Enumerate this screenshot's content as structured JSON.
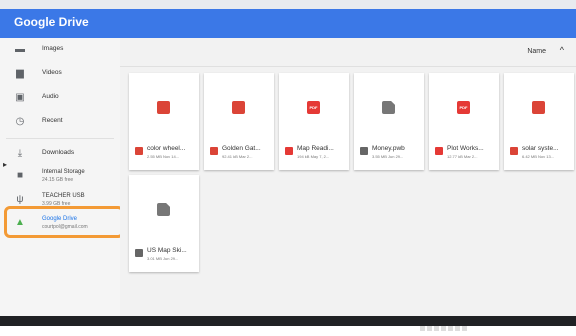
{
  "header": {
    "title": "Google Drive"
  },
  "sidebar": {
    "items": [
      {
        "label": "Images",
        "icon": "image-icon"
      },
      {
        "label": "Videos",
        "icon": "video-icon"
      },
      {
        "label": "Audio",
        "icon": "audio-icon"
      },
      {
        "label": "Recent",
        "icon": "clock-icon"
      },
      {
        "label": "Downloads",
        "icon": "download-icon"
      },
      {
        "label": "Internal Storage",
        "sub": "24.15 GB free",
        "icon": "folder-icon"
      },
      {
        "label": "TEACHER USB",
        "sub": "3.99 GB free",
        "icon": "usb-icon"
      },
      {
        "label": "Google Drive",
        "sub": "courtpol@gmail.com",
        "icon": "drive-icon"
      }
    ]
  },
  "toolbar": {
    "sort_label": "Name",
    "sort_arrow": "^"
  },
  "files": [
    {
      "name": "color wheel...",
      "meta": "2.55 MB Nov 14...",
      "type": "img"
    },
    {
      "name": "Golden Gat...",
      "meta": "92.41 kB Mar 2...",
      "type": "img"
    },
    {
      "name": "Map Readi...",
      "meta": "194 kB May 7, 2...",
      "type": "pdf"
    },
    {
      "name": "Money.pwb",
      "meta": "3.55 MB Jun 29...",
      "type": "doc"
    },
    {
      "name": "Plot Works...",
      "meta": "12.77 kB Mar 2...",
      "type": "pdf"
    },
    {
      "name": "solar syste...",
      "meta": "6.42 MB Nov 13...",
      "type": "img"
    },
    {
      "name": "US Map Ski...",
      "meta": "3.01 MB Jun 29...",
      "type": "doc"
    }
  ],
  "colors": {
    "header": "#3b78e7",
    "highlight": "#f39a35",
    "image": "#db4437",
    "pdf": "#e53935"
  }
}
